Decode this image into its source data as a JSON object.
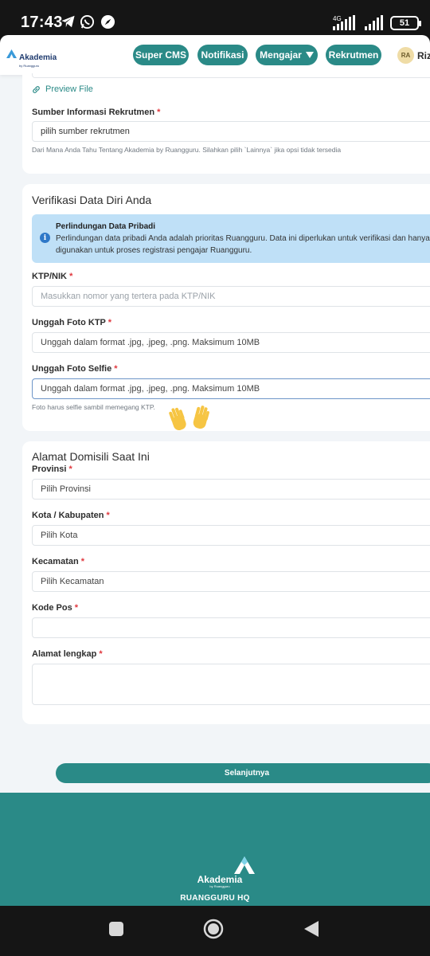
{
  "status_bar": {
    "time": "17:43",
    "network": "4G",
    "battery": "51",
    "icons": [
      "telegram-icon",
      "whatsapp-icon",
      "compass-icon",
      "signal-icon",
      "battery-icon"
    ]
  },
  "nav": {
    "brand": "Akademia",
    "brand_sub": "by Ruangguru",
    "buttons": {
      "super_cms": "Super CMS",
      "notifikasi": "Notifikasi",
      "mengajar": "Mengajar",
      "rekrutmen": "Rekrutmen"
    },
    "avatar_initials": "RA",
    "user_name": "Rizk"
  },
  "recruitment_source": {
    "preview_link": "Preview File",
    "label": "Sumber Informasi Rekrutmen",
    "required": "*",
    "value": "pilih sumber rekrutmen",
    "helper": "Dari Mana Anda Tahu Tentang Akademia by Ruangguru. Silahkan pilih `Lainnya` jika opsi tidak tersedia"
  },
  "identity": {
    "title": "Verifikasi Data Diri Anda",
    "info_title": "Perlindungan Data Pribadi",
    "info_text": "Perlindungan data pribadi Anda adalah prioritas Ruangguru. Data ini diperlukan untuk verifikasi dan hanya digunakan untuk proses registrasi pengajar Ruangguru.",
    "ktp_label": "KTP/NIK",
    "ktp_placeholder": "Masukkan nomor yang tertera pada KTP/NIK",
    "ktp_photo_label": "Unggah Foto KTP",
    "ktp_photo_value": "Unggah dalam format .jpg, .jpeg, .png. Maksimum 10MB",
    "selfie_label": "Unggah Foto Selfie",
    "selfie_value": "Unggah dalam format .jpg, .jpeg, .png. Maksimum 10MB",
    "selfie_helper": "Foto harus selfie sambil memegang KTP.",
    "required": "*"
  },
  "address": {
    "title": "Alamat Domisili Saat Ini",
    "province_label": "Provinsi",
    "province_value": "Pilih Provinsi",
    "city_label": "Kota / Kabupaten",
    "city_value": "Pilih Kota",
    "district_label": "Kecamatan",
    "district_value": "Pilih Kecamatan",
    "postal_label": "Kode Pos",
    "postal_value": "",
    "full_address_label": "Alamat lengkap",
    "full_address_value": "",
    "required": "*"
  },
  "submit_label": "Selanjutnya",
  "footer": {
    "brand": "Akademia",
    "brand_sub": "by Ruangguru",
    "hq": "RUANGGURU HQ"
  },
  "colors": {
    "primary": "#2a8a87",
    "info_bg": "#bfe0f7",
    "required": "#e0383e",
    "brand_text": "#1e3a6e"
  }
}
